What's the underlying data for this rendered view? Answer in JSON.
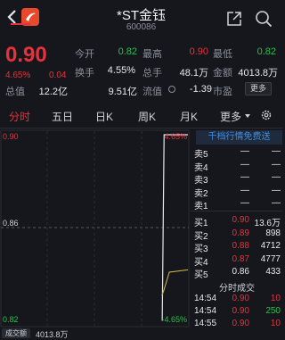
{
  "header": {
    "title": "*ST金钰",
    "code": "600086"
  },
  "quote": {
    "price": "0.90",
    "change_pct": "4.65%",
    "change_abs": "0.04",
    "rows": [
      [
        {
          "label": "今开",
          "value": "0.82",
          "color": "green"
        },
        {
          "label": "最高",
          "value": "0.90",
          "color": "red"
        },
        {
          "label": "最低",
          "value": "0.82",
          "color": "green"
        }
      ],
      [
        {
          "label": "换手",
          "value": "4.55%",
          "color": "white"
        },
        {
          "label": "总手",
          "value": "48.1万",
          "color": "white"
        },
        {
          "label": "金额",
          "value": "4013.8万",
          "color": "white"
        }
      ],
      [
        {
          "label": "总值",
          "value": "12.2亿",
          "color": "white"
        },
        {
          "label": "流值",
          "value": "9.51亿",
          "color": "white"
        },
        {
          "label": "市盈",
          "value": "-1.39",
          "color": "white"
        }
      ]
    ],
    "more": "更多",
    "pe_icon": "dynamic-pe-icon"
  },
  "tabs": [
    "分时",
    "五日",
    "日K",
    "周K",
    "月K",
    "更多"
  ],
  "chart": {
    "y_top": "0.90",
    "y_mid": "0.86",
    "y_bottom": "0.82",
    "pct_top": "4.65%",
    "pct_bottom": "-4.65%"
  },
  "chart_data": {
    "type": "line",
    "title": "",
    "ylim": [
      0.82,
      0.9
    ],
    "mid": 0.86,
    "price_series": [
      {
        "t": 0.86,
        "v": 0.82
      },
      {
        "t": 0.862,
        "v": 0.82
      },
      {
        "t": 0.872,
        "v": 0.9
      },
      {
        "t": 1.0,
        "v": 0.9
      }
    ],
    "avg_series": [
      {
        "t": 0.86,
        "v": 0.82
      },
      {
        "t": 0.87,
        "v": 0.822
      },
      {
        "t": 0.9,
        "v": 0.83
      },
      {
        "t": 1.0,
        "v": 0.831
      }
    ],
    "volume_label": "成交额",
    "volume_value": "4013.8万"
  },
  "orderbook": {
    "promo": "千档行情免费送",
    "asks": [
      {
        "label": "卖5",
        "price": "—",
        "vol": "—"
      },
      {
        "label": "卖4",
        "price": "—",
        "vol": "—"
      },
      {
        "label": "卖3",
        "price": "—",
        "vol": "—"
      },
      {
        "label": "卖2",
        "price": "—",
        "vol": "—"
      },
      {
        "label": "卖1",
        "price": "—",
        "vol": "—"
      }
    ],
    "bids": [
      {
        "label": "买1",
        "price": "0.90",
        "vol": "13.6万",
        "pcolor": "red"
      },
      {
        "label": "买2",
        "price": "0.89",
        "vol": "898",
        "pcolor": "red"
      },
      {
        "label": "买3",
        "price": "0.88",
        "vol": "4712",
        "pcolor": "red"
      },
      {
        "label": "买4",
        "price": "0.87",
        "vol": "4777",
        "pcolor": "red"
      },
      {
        "label": "买5",
        "price": "0.86",
        "vol": "433",
        "pcolor": "white"
      }
    ],
    "ticks_title": "分时成交",
    "ticks": [
      {
        "time": "14:54",
        "price": "0.90",
        "vol": "10",
        "vcolor": "red"
      },
      {
        "time": "14:54",
        "price": "0.90",
        "vol": "250",
        "vcolor": "green"
      },
      {
        "time": "14:55",
        "price": "0.90",
        "vol": "10",
        "vcolor": "red"
      }
    ]
  }
}
